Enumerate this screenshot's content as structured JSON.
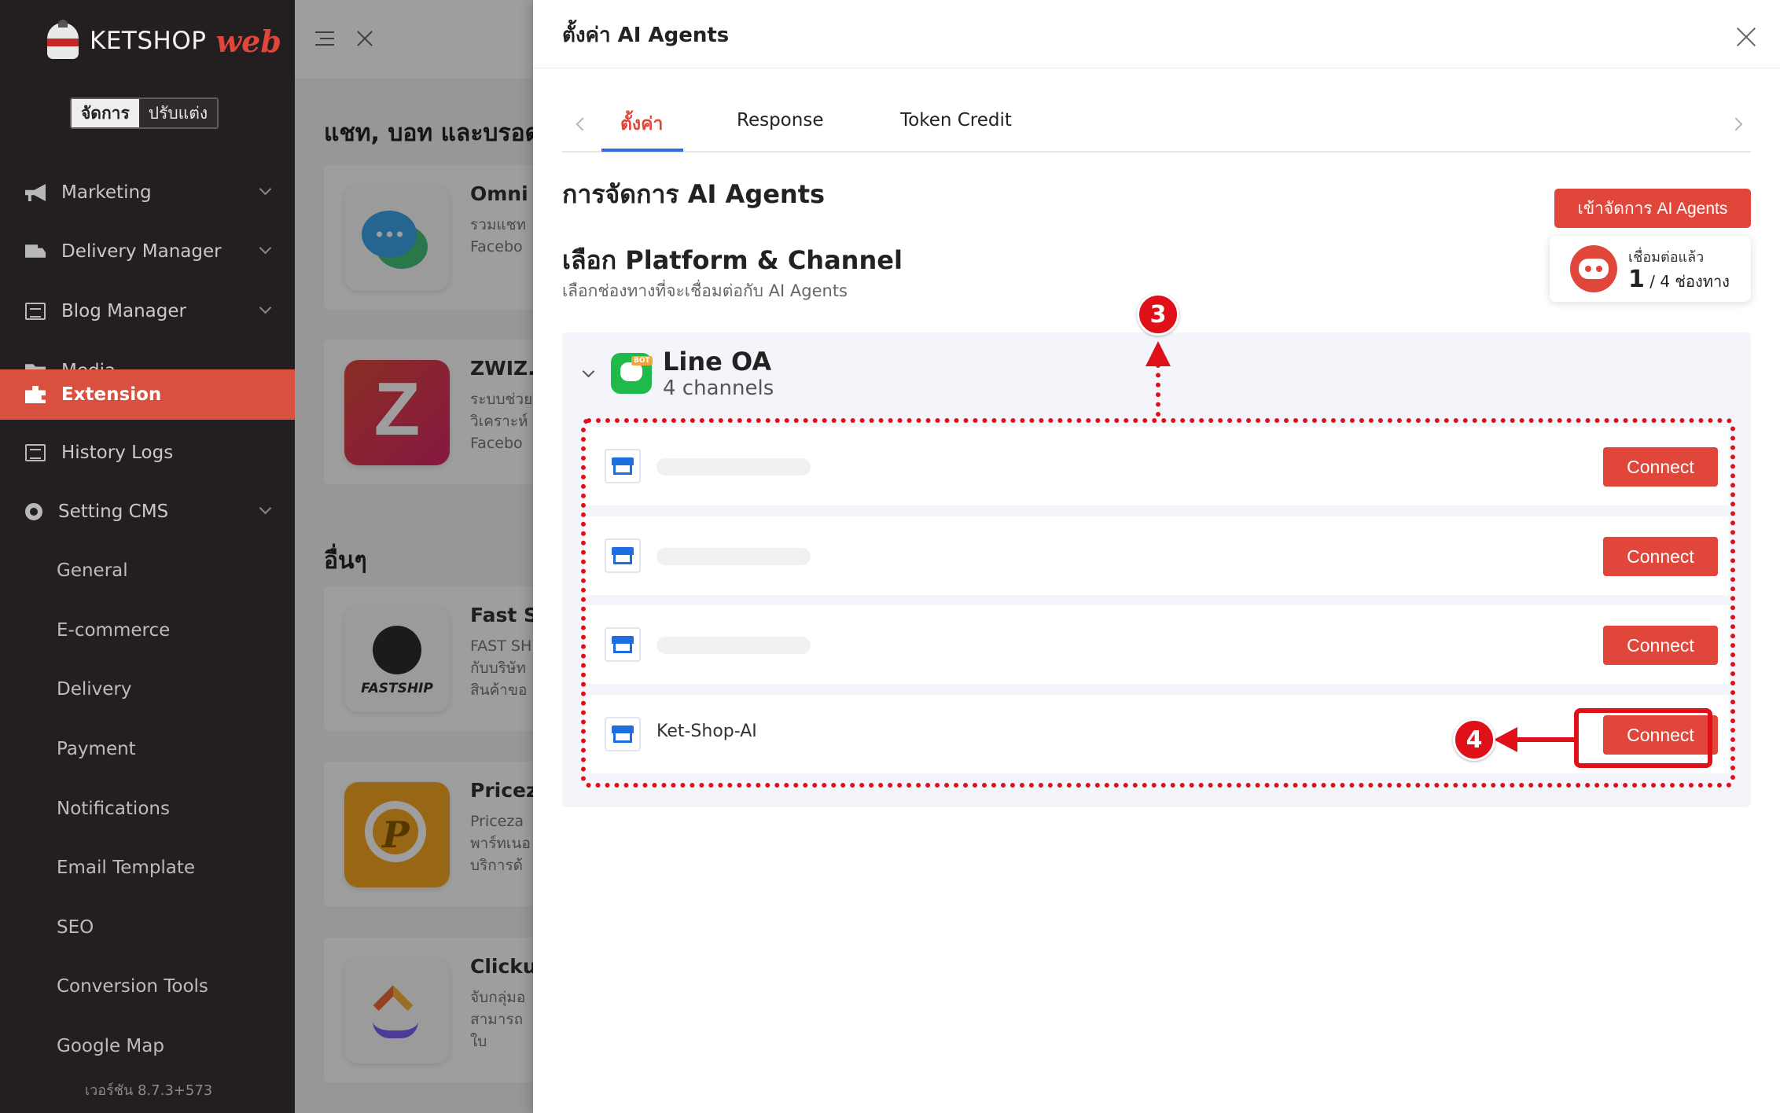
{
  "sidebar": {
    "logo_text": "KETSHOP",
    "logo_accent": "web",
    "mode_active": "จัดการ",
    "mode_other": "ปรับแต่ง",
    "items": [
      {
        "label": "Marketing",
        "icon": "megaphone-icon",
        "has_children": true
      },
      {
        "label": "Delivery Manager",
        "icon": "truck-icon",
        "has_children": true
      },
      {
        "label": "Blog Manager",
        "icon": "blog-icon",
        "has_children": true
      },
      {
        "label": "Media",
        "icon": "folder-icon",
        "has_children": false
      },
      {
        "label": "Extension",
        "icon": "puzzle-icon",
        "has_children": false,
        "active": true
      },
      {
        "label": "History Logs",
        "icon": "list-icon",
        "has_children": false
      },
      {
        "label": "Setting CMS",
        "icon": "gear-icon",
        "has_children": true
      }
    ],
    "sub_items": [
      "General",
      "E-commerce",
      "Delivery",
      "Payment",
      "Notifications",
      "Email Template",
      "SEO",
      "Conversion Tools",
      "Google Map"
    ],
    "version": "เวอร์ชัน 8.7.3+573"
  },
  "background_page": {
    "heading": "แชท, บอท และบรอด",
    "heading_other": "อื่นๆ",
    "cards": [
      {
        "title": "Omni",
        "desc": [
          "รวมแชท",
          "Facebo"
        ]
      },
      {
        "title": "ZWIZ.A",
        "desc": [
          "ระบบช่วย",
          "วิเคราะห์",
          "Facebo"
        ]
      },
      {
        "title": "Fast S",
        "desc": [
          "FAST SH",
          "กับบริษัท",
          "สินค้าขอ"
        ]
      },
      {
        "title": "Pricez",
        "desc": [
          "Priceza",
          "พาร์ทเนอ",
          "บริการด้"
        ]
      },
      {
        "title": "Clicku",
        "desc": [
          "จับกลุ่มอ",
          "สามารถ",
          "ใบ"
        ]
      }
    ]
  },
  "panel": {
    "title": "ตั้งค่า AI Agents",
    "tabs": [
      "ตั้งค่า",
      "Response",
      "Token Credit"
    ],
    "section_title": "การจัดการ AI Agents",
    "manage_button": "เข้าจัดการ AI Agents",
    "status_label": "เชื่อมต่อแล้ว",
    "status_connected": "1",
    "status_total": "/ 4 ช่องทาง",
    "platform_title": "เลือก Platform & Channel",
    "platform_desc": "เลือกช่องทางที่จะเชื่อมต่อกับ AI Agents",
    "platform": {
      "name": "Line OA",
      "count": "4 channels",
      "logo_badge": "BOT",
      "channels": [
        {
          "name": "",
          "button": "Connect"
        },
        {
          "name": "",
          "button": "Connect"
        },
        {
          "name": "",
          "button": "Connect"
        },
        {
          "name": "Ket-Shop-AI",
          "button": "Connect"
        }
      ]
    }
  },
  "annotations": {
    "step_3": "3",
    "step_4": "4",
    "color": "#e01019"
  },
  "colors": {
    "accent": "#e0463a",
    "sidebar_bg": "#231f20",
    "tab_underline": "#2d6bdf",
    "line_green": "#1fba4b"
  }
}
